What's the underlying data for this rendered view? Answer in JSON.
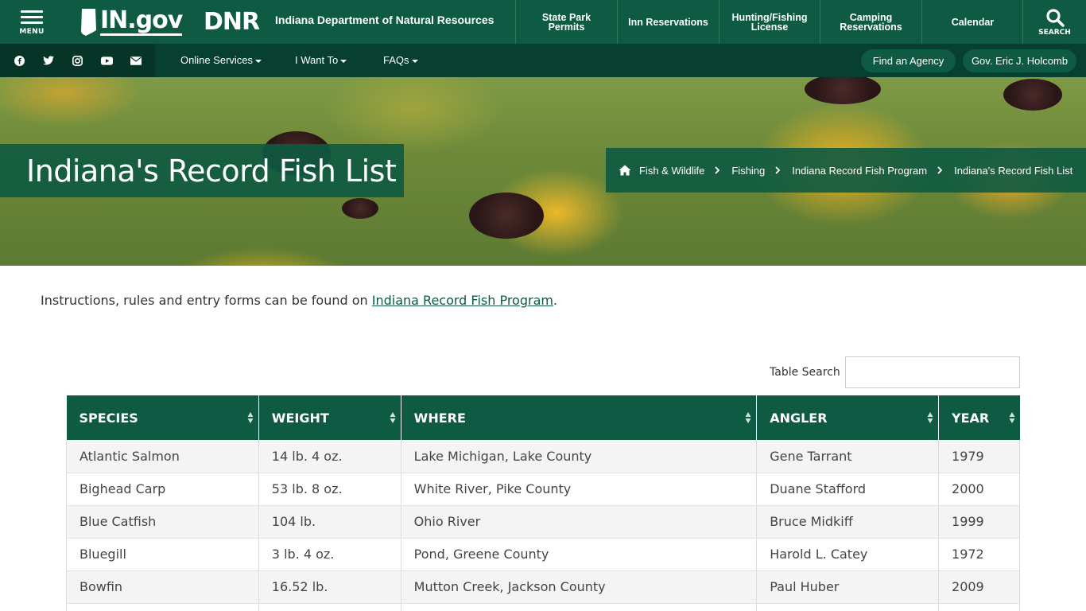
{
  "header": {
    "menu_label": "MENU",
    "ingov_logo": "IN.gov",
    "dnr_logo": "DNR",
    "agency_title": "Indiana Department of Natural Resources",
    "nav": [
      {
        "line1": "State Park",
        "line2": "Permits"
      },
      {
        "line1": "Inn Reservations",
        "line2": ""
      },
      {
        "line1": "Hunting/Fishing",
        "line2": "License"
      },
      {
        "line1": "Camping",
        "line2": "Reservations"
      },
      {
        "line1": "Calendar",
        "line2": ""
      }
    ],
    "search_label": "SEARCH"
  },
  "subbar": {
    "social": [
      "facebook-icon",
      "twitter-icon",
      "instagram-icon",
      "youtube-icon",
      "email-icon"
    ],
    "menus": [
      "Online Services",
      "I Want To",
      "FAQs"
    ],
    "find_agency": "Find an Agency",
    "governor": "Gov. Eric J. Holcomb"
  },
  "hero": {
    "title": "Indiana's Record Fish List",
    "breadcrumb": [
      "Fish & Wildlife",
      "Fishing",
      "Indiana Record Fish Program",
      "Indiana's Record Fish List"
    ]
  },
  "intro": {
    "text_before": "Instructions, rules and entry forms can be found on ",
    "link": "Indiana Record Fish Program",
    "text_after": "."
  },
  "table_search": {
    "label": "Table Search",
    "value": ""
  },
  "table": {
    "columns": [
      "SPECIES",
      "WEIGHT",
      "WHERE",
      "ANGLER",
      "YEAR"
    ],
    "rows": [
      [
        "Atlantic Salmon",
        "14 lb. 4 oz.",
        "Lake Michigan, Lake County",
        "Gene Tarrant",
        "1979"
      ],
      [
        "Bighead Carp",
        "53 lb. 8 oz.",
        "White River, Pike County",
        "Duane Stafford",
        "2000"
      ],
      [
        "Blue Catfish",
        "104 lb.",
        "Ohio River",
        "Bruce Midkiff",
        "1999"
      ],
      [
        "Bluegill",
        "3 lb. 4 oz.",
        "Pond, Greene County",
        "Harold L. Catey",
        "1972"
      ],
      [
        "Bowfin",
        "16.52 lb.",
        "Mutton Creek, Jackson County",
        "Paul Huber",
        "2009"
      ],
      [
        "",
        "",
        "",
        "",
        ""
      ]
    ]
  },
  "colors": {
    "brand_green": "#0e5a43",
    "dark_green": "#073f30"
  }
}
